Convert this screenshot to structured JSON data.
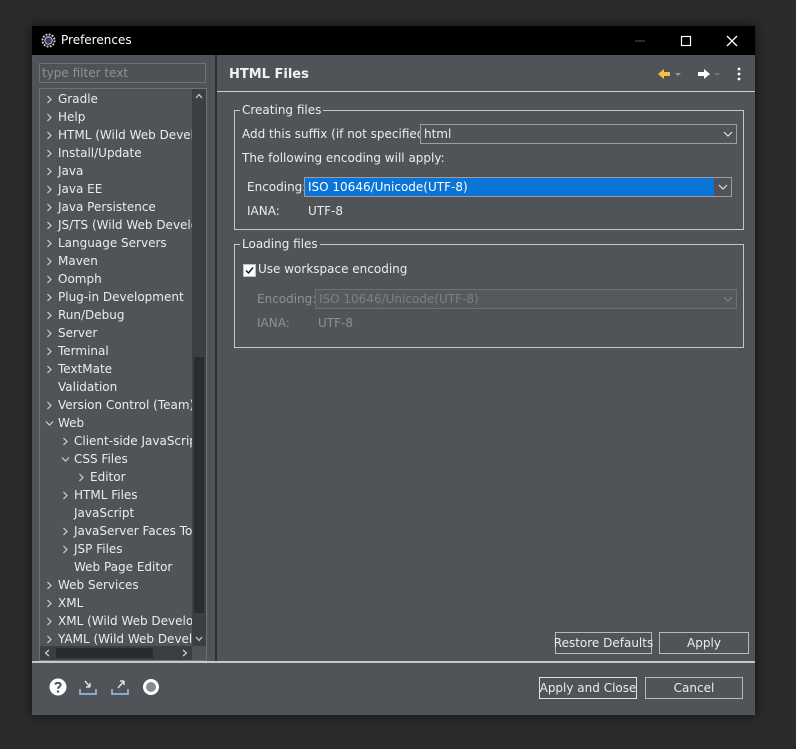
{
  "window": {
    "title": "Preferences",
    "icon": "eclipse-gear-icon"
  },
  "filter": {
    "placeholder": "type filter text"
  },
  "tree": {
    "items": [
      {
        "label": "Gradle",
        "expander": "collapsed"
      },
      {
        "label": "Help",
        "expander": "collapsed"
      },
      {
        "label": "HTML (Wild Web Develo",
        "expander": "collapsed"
      },
      {
        "label": "Install/Update",
        "expander": "collapsed"
      },
      {
        "label": "Java",
        "expander": "collapsed"
      },
      {
        "label": "Java EE",
        "expander": "collapsed"
      },
      {
        "label": "Java Persistence",
        "expander": "collapsed"
      },
      {
        "label": "JS/TS (Wild Web Develo",
        "expander": "collapsed"
      },
      {
        "label": "Language Servers",
        "expander": "collapsed"
      },
      {
        "label": "Maven",
        "expander": "collapsed"
      },
      {
        "label": "Oomph",
        "expander": "collapsed"
      },
      {
        "label": "Plug-in Development",
        "expander": "collapsed"
      },
      {
        "label": "Run/Debug",
        "expander": "collapsed"
      },
      {
        "label": "Server",
        "expander": "collapsed"
      },
      {
        "label": "Terminal",
        "expander": "collapsed"
      },
      {
        "label": "TextMate",
        "expander": "collapsed"
      },
      {
        "label": "Validation",
        "expander": "none"
      },
      {
        "label": "Version Control (Team)",
        "expander": "collapsed"
      },
      {
        "label": "Web",
        "expander": "expanded"
      },
      {
        "label": "Client-side JavaScript",
        "expander": "collapsed"
      },
      {
        "label": "CSS Files",
        "expander": "expanded"
      },
      {
        "label": "Editor",
        "expander": "collapsed"
      },
      {
        "label": "HTML Files",
        "expander": "collapsed"
      },
      {
        "label": "JavaScript",
        "expander": "none"
      },
      {
        "label": "JavaServer Faces Tools",
        "expander": "collapsed"
      },
      {
        "label": "JSP Files",
        "expander": "collapsed"
      },
      {
        "label": "Web Page Editor",
        "expander": "none"
      },
      {
        "label": "Web Services",
        "expander": "collapsed"
      },
      {
        "label": "XML",
        "expander": "collapsed"
      },
      {
        "label": "XML (Wild Web Develop",
        "expander": "collapsed"
      },
      {
        "label": "YAML (Wild Web Develo",
        "expander": "collapsed"
      }
    ]
  },
  "page": {
    "title": "HTML Files",
    "nav": {
      "back_icon": "back-arrow-icon",
      "forward_icon": "forward-arrow-icon",
      "menu_icon": "view-menu-icon"
    }
  },
  "creating": {
    "legend": "Creating files",
    "suffix_label": "Add this suffix (if not specified):",
    "suffix_value": "html",
    "encoding_note": "The following encoding will apply:",
    "encoding_label": "Encoding:",
    "encoding_value": "ISO 10646/Unicode(UTF-8)",
    "iana_label": "IANA:",
    "iana_value": "UTF-8"
  },
  "loading": {
    "legend": "Loading files",
    "use_workspace_label": "Use workspace encoding",
    "use_workspace_checked": true,
    "encoding_label": "Encoding:",
    "encoding_value": "ISO 10646/Unicode(UTF-8)",
    "iana_label": "IANA:",
    "iana_value": "UTF-8"
  },
  "buttons": {
    "restore_defaults": "Restore Defaults",
    "apply": "Apply",
    "apply_close": "Apply and Close",
    "cancel": "Cancel"
  },
  "footer_icons": [
    "help-icon",
    "import-icon",
    "export-icon",
    "oomph-record-icon"
  ],
  "colors": {
    "selection": "#0a74d7",
    "background": "#505458",
    "titlebar": "#000000"
  }
}
